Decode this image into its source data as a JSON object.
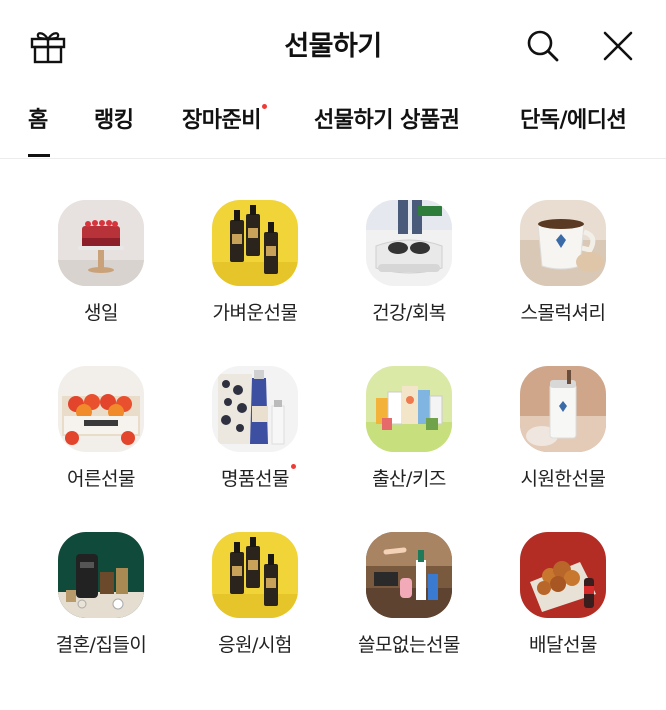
{
  "header": {
    "title": "선물하기",
    "left_icon": "gift-icon",
    "right_icons": [
      "search-icon",
      "close-icon"
    ]
  },
  "tabs": [
    {
      "label": "홈",
      "active": true,
      "dot": false
    },
    {
      "label": "랭킹",
      "active": false,
      "dot": false
    },
    {
      "label": "장마준비",
      "active": false,
      "dot": true
    },
    {
      "label": "선물하기 상품권",
      "active": false,
      "dot": false
    },
    {
      "label": "단독/에디션",
      "active": false,
      "dot": false
    }
  ],
  "categories": [
    {
      "label": "생일",
      "image": "birthday-cake",
      "dot": false
    },
    {
      "label": "가벼운선물",
      "image": "serum-bottles-yellow",
      "dot": false
    },
    {
      "label": "건강/회복",
      "image": "foot-massager",
      "dot": false
    },
    {
      "label": "스몰럭셔리",
      "image": "coffee-cup",
      "dot": false
    },
    {
      "label": "어른선물",
      "image": "fruit-box",
      "dot": false
    },
    {
      "label": "명품선물",
      "image": "hand-cream",
      "dot": true
    },
    {
      "label": "출산/키즈",
      "image": "kids-products",
      "dot": false
    },
    {
      "label": "시원한선물",
      "image": "tumbler",
      "dot": false
    },
    {
      "label": "결혼/집들이",
      "image": "coffee-machine",
      "dot": false
    },
    {
      "label": "응원/시험",
      "image": "serum-bottles-yellow",
      "dot": false
    },
    {
      "label": "쓸모없는선물",
      "image": "desk-gadgets",
      "dot": false
    },
    {
      "label": "배달선물",
      "image": "fried-chicken",
      "dot": false
    }
  ],
  "colors": {
    "accent_dot": "#ef3b36",
    "text": "#111111",
    "divider": "#ececec"
  }
}
